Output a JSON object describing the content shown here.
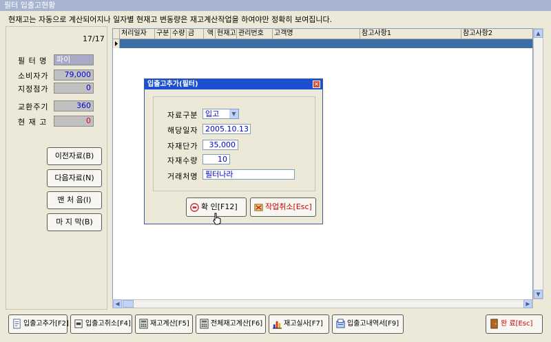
{
  "window": {
    "title": "필터 입출고현황"
  },
  "notice": "현재고는 자동으로 계산되어지나 일자별 현재고 변동량은 재고계산작업을 하여야만 정확히 보여집니다.",
  "left_panel": {
    "counter": "17/17",
    "fields": [
      {
        "label": "필 터 명",
        "value": "파이"
      },
      {
        "label": "소비자가",
        "value": "79,000"
      },
      {
        "label": "지정점가",
        "value": "0"
      },
      {
        "label": "교환주기",
        "value": "360"
      },
      {
        "label": "현 재 고",
        "value": "0"
      }
    ],
    "nav_buttons": [
      "이전자료(B)",
      "다음자료(N)",
      "맨 처 음(I)",
      "마 지 막(B)"
    ]
  },
  "grid": {
    "columns": [
      "처리일자",
      "구분",
      "수량",
      "금",
      "액",
      "현재고",
      "관리번호",
      "고객명",
      "참고사항1",
      "참고사항2"
    ]
  },
  "dialog": {
    "title": "입출고추가(필터)",
    "fields": [
      {
        "label": "자료구분",
        "value": "입고"
      },
      {
        "label": "해당일자",
        "value": "2005.10.13"
      },
      {
        "label": "자재단가",
        "value": "35,000"
      },
      {
        "label": "자재수량",
        "value": "10"
      },
      {
        "label": "거래처명",
        "value": "필터나라"
      }
    ],
    "ok_button": "확 인[F12]",
    "cancel_button": "작업취소[Esc]"
  },
  "bottom_buttons": [
    "입출고추가[F2]",
    "입출고취소[F4]",
    "재고계산[F5]",
    "전체재고계산[F6]",
    "재고실사[F7]",
    "입출고내역서[F9]",
    "완 료[Esc]"
  ],
  "colors": {
    "selected_row": "#3a6ea5",
    "dialog_title": "#1b51d0",
    "field_text": "#0000cc",
    "stock_text": "#e00000"
  }
}
